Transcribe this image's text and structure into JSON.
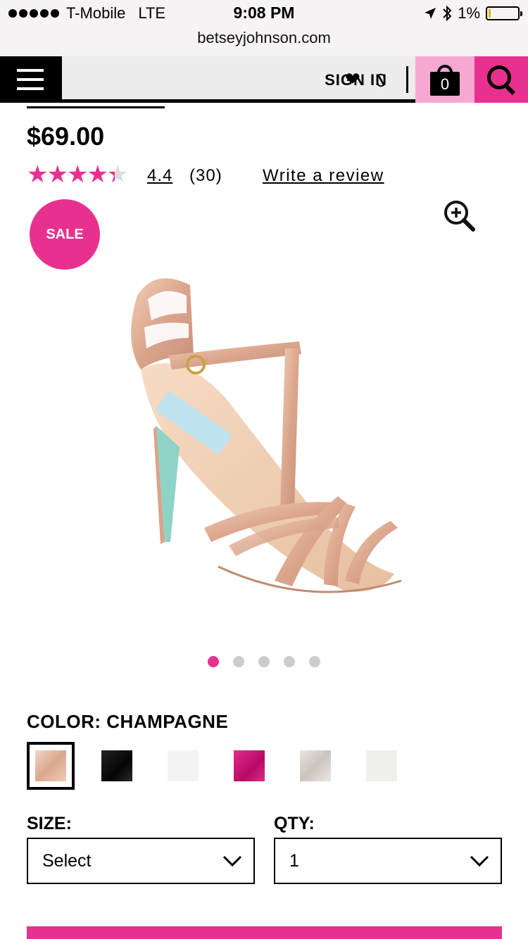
{
  "status_bar": {
    "carrier": "T-Mobile",
    "network": "LTE",
    "time": "9:08 PM",
    "battery": "1%",
    "url": "betseyjohnson.com"
  },
  "nav": {
    "menu_icon": "hamburger-menu-icon",
    "sign_in": "SIGN IN",
    "wishlist_count": "0",
    "cart_count": "0",
    "brand_pink": "#e8318f",
    "light_pink": "#f7a8d2"
  },
  "product": {
    "price": "$69.00",
    "rating_value": "4.4",
    "rating_count": "(30)",
    "rating_fraction": 0.88,
    "write_review": "Write a review",
    "sale_badge": "SALE",
    "image_alt": "Champagne glitter T-strap heeled sandal",
    "carousel": {
      "total": 5,
      "active": 1
    }
  },
  "color": {
    "label": "COLOR:",
    "selected": "CHAMPAGNE",
    "swatches": [
      {
        "name": "champagne",
        "hex": "#e3bfa8"
      },
      {
        "name": "black",
        "hex": "#111111"
      },
      {
        "name": "white",
        "hex": "#f4f4f4"
      },
      {
        "name": "fuchsia",
        "hex": "#d2127a"
      },
      {
        "name": "silver",
        "hex": "#dcd8d2"
      },
      {
        "name": "ivory",
        "hex": "#f2f2ee"
      }
    ]
  },
  "size": {
    "label": "SIZE:",
    "value": "Select"
  },
  "qty": {
    "label": "QTY:",
    "value": "1"
  }
}
